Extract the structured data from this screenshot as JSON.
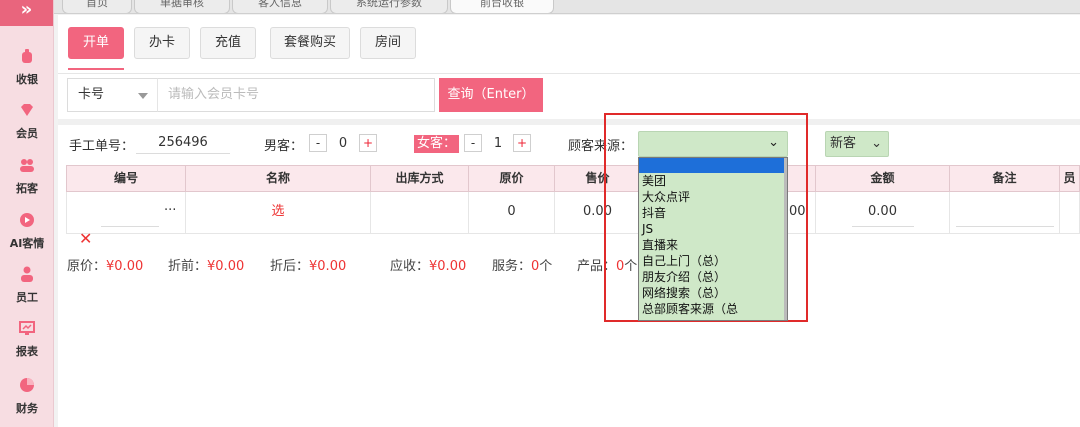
{
  "sidebar": {
    "items": [
      {
        "label": "收银",
        "icon": "cashier-icon"
      },
      {
        "label": "会员",
        "icon": "diamond-icon"
      },
      {
        "label": "拓客",
        "icon": "users-icon"
      },
      {
        "label": "AI客情",
        "icon": "play-icon"
      },
      {
        "label": "员工",
        "icon": "person-icon"
      },
      {
        "label": "报表",
        "icon": "report-icon"
      },
      {
        "label": "财务",
        "icon": "pie-icon"
      }
    ],
    "collapse_glyph": "»"
  },
  "top_tabs": [
    {
      "label": "首页"
    },
    {
      "label": "单据审核"
    },
    {
      "label": "客人信息"
    },
    {
      "label": "系统运行参数"
    },
    {
      "label": "前台收银"
    }
  ],
  "sub_tabs": [
    {
      "label": "开单"
    },
    {
      "label": "办卡"
    },
    {
      "label": "充值"
    },
    {
      "label": "套餐购买"
    },
    {
      "label": "房间"
    }
  ],
  "search": {
    "card_type": "卡号",
    "placeholder": "请输入会员卡号",
    "query_button": "查询（Enter）"
  },
  "form": {
    "manual_no_label": "手工单号：",
    "manual_no_value": "256496",
    "male_label": "男客：",
    "male_count": "0",
    "female_label": "女客：",
    "female_count": "1",
    "minus": "-",
    "plus": "+",
    "source_label": "顾客来源：",
    "customer_type": "新客"
  },
  "table": {
    "headers": [
      "编号",
      "名称",
      "出库方式",
      "原价",
      "售价",
      "",
      "",
      "金额",
      "备注",
      "员"
    ],
    "row": {
      "delete_glyph": "✕",
      "more": "...",
      "name": "选",
      "original_price": "0",
      "sale_price": "0.00",
      "hidden_value": "00",
      "amount": "0.00"
    }
  },
  "summary": {
    "original_label": "原价：",
    "original_value": "¥0.00",
    "before_discount_label": "折前：",
    "before_discount_value": "¥0.00",
    "after_discount_label": "折后：",
    "after_discount_value": "¥0.00",
    "receivable_label": "应收：",
    "receivable_value": "¥0.00",
    "service_label": "服务：",
    "service_value": "0",
    "service_unit": "个",
    "product_label": "产品：",
    "product_value": "0",
    "product_unit": "个"
  },
  "source_dropdown": {
    "options": [
      "美团",
      "大众点评",
      "抖音",
      "JS",
      "直播来",
      "自己上门（总）",
      "朋友介绍（总）",
      "网络搜索（总）",
      "总部顾客来源（总"
    ]
  },
  "colors": {
    "accent": "#f2657f",
    "sidebar_bg": "#f7dde2",
    "dropdown_bg": "#cfe8c8",
    "selection_blue": "#1e6fd9",
    "highlight_red": "#e02a2a",
    "value_red": "#e33333"
  }
}
